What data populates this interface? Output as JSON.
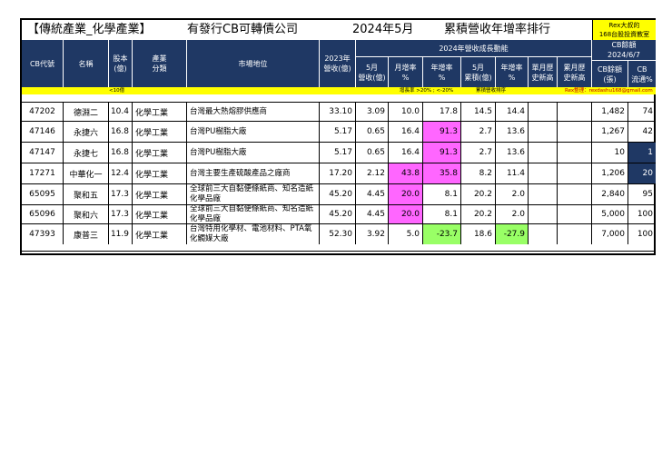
{
  "title": {
    "category": "【傳統產業_化學產業】",
    "subject": "有發行CB可轉債公司",
    "period": "2024年5月",
    "ranking": "累積營收年增率排行"
  },
  "badge": {
    "line1": "Rex大叔的",
    "line2": "168台股投資教室"
  },
  "header": {
    "cb_code": "CB代號",
    "name": "名稱",
    "capital": "股本\n(億)",
    "industry": "產業\n分類",
    "market_position": "市場地位",
    "revenue_2023": "2023年\n營收(億)",
    "group_2024": "2024年營收成長動能",
    "may_revenue": "5月\n營收(億)",
    "mom": "月增率\n%",
    "yoy": "年增率\n%",
    "may_cumulative": "5月\n累積(億)",
    "cum_yoy": "年增率\n%",
    "single_month_high": "單月歷\n史新高",
    "cum_high": "累月歷\n史新高",
    "cb_balance_group": "CB餘額\n2024/6/7",
    "cb_balance": "CB餘額\n(張)",
    "cb_float": "CB\n流通%"
  },
  "legend": {
    "capital_note": "<10億",
    "growth_note": "增長率 >20% ; <-20%",
    "cum_note": "累積營收排序",
    "author_note": "Rex整理：rexdashu168@gmail.com"
  },
  "rows": [
    {
      "code": "47202",
      "name": "德淵二",
      "capital": "10.4",
      "industry": "化學工業",
      "position": "台灣最大熱熔膠供應商",
      "rev2023": "33.10",
      "may": "3.09",
      "mom": "10.0",
      "yoy": "17.8",
      "cum": "14.5",
      "cum_yoy": "14.4",
      "single_high": "",
      "cum_high": "",
      "cb_balance": "1,482",
      "cb_float": "74",
      "highlight": {}
    },
    {
      "code": "47146",
      "name": "永捷六",
      "capital": "16.8",
      "industry": "化學工業",
      "position": "台灣PU樹脂大廠",
      "rev2023": "5.17",
      "may": "0.65",
      "mom": "16.4",
      "yoy": "91.3",
      "cum": "2.7",
      "cum_yoy": "13.6",
      "single_high": "",
      "cum_high": "",
      "cb_balance": "1,267",
      "cb_float": "42",
      "highlight": {
        "yoy": "pink"
      }
    },
    {
      "code": "47147",
      "name": "永捷七",
      "capital": "16.8",
      "industry": "化學工業",
      "position": "台灣PU樹脂大廠",
      "rev2023": "5.17",
      "may": "0.65",
      "mom": "16.4",
      "yoy": "91.3",
      "cum": "2.7",
      "cum_yoy": "13.6",
      "single_high": "",
      "cum_high": "",
      "cb_balance": "10",
      "cb_float": "1",
      "highlight": {
        "yoy": "pink",
        "cb_float": "navy"
      }
    },
    {
      "code": "17271",
      "name": "中華化一",
      "capital": "12.4",
      "industry": "化學工業",
      "position": "台灣主要生產硫酸產品之廠商",
      "rev2023": "17.20",
      "may": "2.12",
      "mom": "43.8",
      "yoy": "35.8",
      "cum": "8.2",
      "cum_yoy": "11.4",
      "single_high": "",
      "cum_high": "",
      "cb_balance": "1,206",
      "cb_float": "20",
      "highlight": {
        "mom": "pink",
        "yoy": "pink",
        "cb_float": "navy"
      }
    },
    {
      "code": "65095",
      "name": "聚和五",
      "capital": "17.3",
      "industry": "化學工業",
      "position": "全球前三大自黏便條紙商、知名造紙化學品廠",
      "rev2023": "45.20",
      "may": "4.45",
      "mom": "20.0",
      "yoy": "8.1",
      "cum": "20.2",
      "cum_yoy": "2.0",
      "single_high": "",
      "cum_high": "",
      "cb_balance": "2,840",
      "cb_float": "95",
      "highlight": {
        "mom": "pink"
      }
    },
    {
      "code": "65096",
      "name": "聚和六",
      "capital": "17.3",
      "industry": "化學工業",
      "position": "全球前三大自黏便條紙商、知名造紙化學品廠",
      "rev2023": "45.20",
      "may": "4.45",
      "mom": "20.0",
      "yoy": "8.1",
      "cum": "20.2",
      "cum_yoy": "2.0",
      "single_high": "",
      "cum_high": "",
      "cb_balance": "5,000",
      "cb_float": "100",
      "highlight": {
        "mom": "pink"
      }
    },
    {
      "code": "47393",
      "name": "康普三",
      "capital": "11.9",
      "industry": "化學工業",
      "position": "台灣特用化學材、電池材料、PTA氧化觸媒大廠",
      "rev2023": "52.30",
      "may": "3.92",
      "mom": "5.0",
      "yoy": "-23.7",
      "cum": "18.6",
      "cum_yoy": "-27.9",
      "single_high": "",
      "cum_high": "",
      "cb_balance": "7,000",
      "cb_float": "100",
      "highlight": {
        "yoy": "green",
        "cum_yoy": "green"
      }
    }
  ],
  "colors": {
    "header_bg": "#1f3864",
    "legend_bg": "#ffff00",
    "up_highlight": "#ff66ff",
    "down_highlight": "#99ff66"
  }
}
